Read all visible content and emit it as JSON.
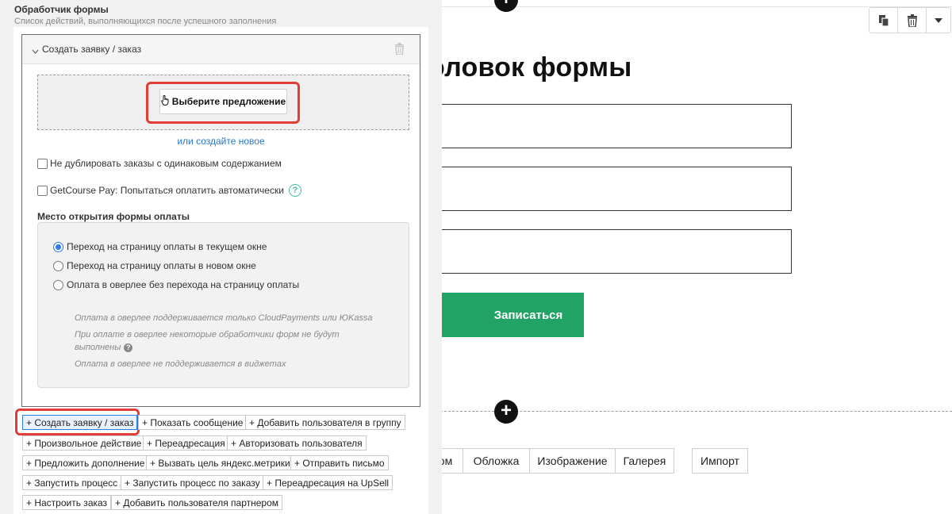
{
  "panel": {
    "title": "Обработчик формы",
    "subtitle": "Список действий, выполняющихся после успешного заполнения",
    "card": {
      "title": "Создать заявку / заказ",
      "offer_button": "Выберите предложение",
      "create_new_link": "или создайте новое",
      "no_duplicate_label": "Не дублировать заказы с одинаковым содержанием",
      "getcourse_pay_label": "GetCourse Pay: Попытаться оплатить автоматически",
      "help_symbol": "?",
      "payment_section_label": "Место открытия формы оплаты",
      "payment_options": [
        {
          "label": "Переход на страницу оплаты в текущем окне",
          "selected": true
        },
        {
          "label": "Переход на страницу оплаты в новом окне",
          "selected": false
        },
        {
          "label": "Оплата в оверлее без перехода на страницу оплаты",
          "selected": false
        }
      ],
      "notes": {
        "note1": "Оплата в оверлее поддерживается только CloudPayments или ЮKassa",
        "note2_line1": "При оплате в оверлее некоторые обработчики форм не будут",
        "note2_line2": "выполнены",
        "note3": "Оплата в оверлее не поддерживается в виджетах"
      }
    },
    "actions": [
      "+ Создать заявку / заказ",
      "+ Показать сообщение",
      "+ Добавить пользователя в группу",
      "+ Произвольное действие",
      "+ Переадресация",
      "+ Авторизовать пользователя",
      "+ Предложить дополнение",
      "+ Вызвать цель яндекс.метрики",
      "+ Отправить письмо",
      "+ Запустить процесс",
      "+ Запустить процесс по заказу",
      "+ Переадресация на UpSell",
      "+ Настроить заказ",
      "+ Добавить пользователя партнером"
    ]
  },
  "editor": {
    "form_title_visible": "оловок формы",
    "submit_label": "Записаться",
    "block_buttons": [
      "ом",
      "Обложка",
      "Изображение",
      "Галерея",
      "Импорт"
    ]
  },
  "colors": {
    "accent_green": "#21a366",
    "highlight_red": "#e23d36",
    "link_blue": "#2a77c4"
  }
}
